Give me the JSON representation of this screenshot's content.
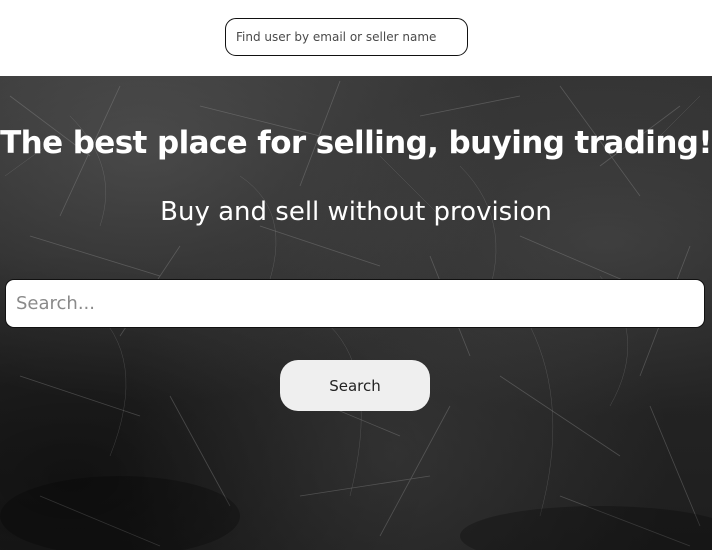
{
  "header": {
    "user_search_placeholder": "Find user by email or seller name"
  },
  "hero": {
    "title": "The best place for selling, buying trading!",
    "subtitle": "Buy and sell without provision",
    "search_placeholder": "Search...",
    "search_button_label": "Search"
  },
  "colors": {
    "hero_background": "#2a2a2a",
    "hero_text": "#ffffff",
    "button_background": "#efefef"
  }
}
